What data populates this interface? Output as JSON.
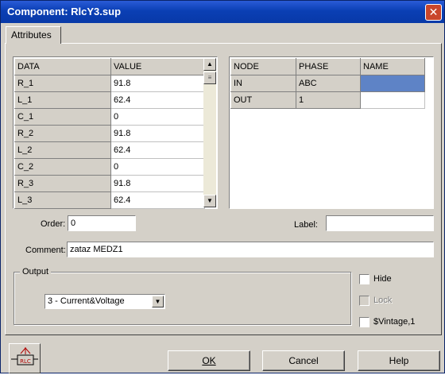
{
  "window": {
    "title": "Component: RlcY3.sup",
    "close_glyph": "✕"
  },
  "tabs": [
    {
      "label": "Attributes"
    }
  ],
  "data_grid": {
    "headers": [
      "DATA",
      "VALUE"
    ],
    "rows": [
      {
        "name": "R_1",
        "value": "91.8"
      },
      {
        "name": "L_1",
        "value": "62.4"
      },
      {
        "name": "C_1",
        "value": "0"
      },
      {
        "name": "R_2",
        "value": "91.8"
      },
      {
        "name": "L_2",
        "value": "62.4"
      },
      {
        "name": "C_2",
        "value": "0"
      },
      {
        "name": "R_3",
        "value": "91.8"
      },
      {
        "name": "L_3",
        "value": "62.4"
      }
    ]
  },
  "node_grid": {
    "headers": [
      "NODE",
      "PHASE",
      "NAME"
    ],
    "rows": [
      {
        "node": "IN",
        "phase": "ABC",
        "name": ""
      },
      {
        "node": "OUT",
        "phase": "1",
        "name": ""
      }
    ]
  },
  "fields": {
    "order_label": "Order:",
    "order_value": "0",
    "label_label": "Label:",
    "label_value": "",
    "comment_label": "Comment:",
    "comment_value": "zataz MEDZ1"
  },
  "output": {
    "group_title": "Output",
    "selected": "3 - Current&Voltage"
  },
  "checkboxes": {
    "hide": {
      "label": "Hide",
      "checked": false
    },
    "lock": {
      "label": "Lock",
      "checked": false,
      "enabled": false
    },
    "vintage": {
      "label": "$Vintage,1",
      "checked": false
    }
  },
  "buttons": {
    "ok": "OK",
    "cancel": "Cancel",
    "help": "Help"
  },
  "component_icon": {
    "text": "RLC",
    "icon": "rlc-component-icon"
  }
}
